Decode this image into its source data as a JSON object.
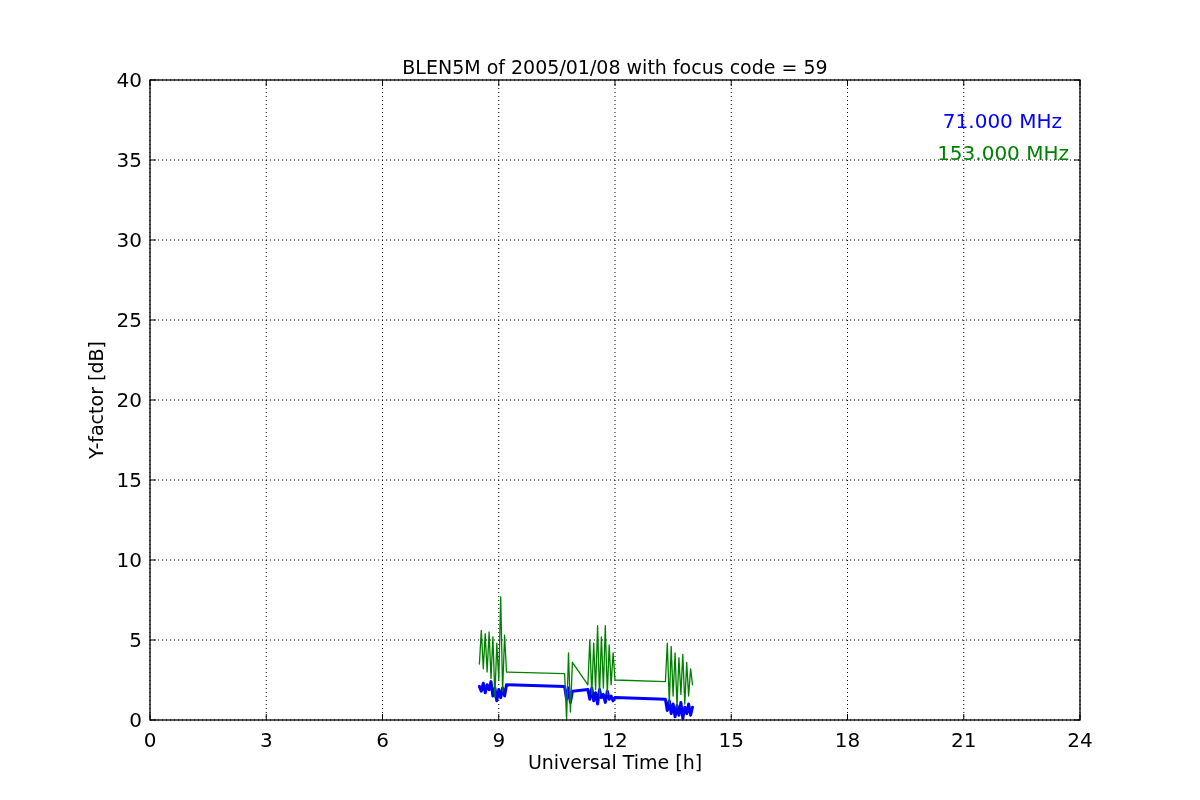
{
  "figure": {
    "chart_data": {
      "type": "line",
      "grid": true,
      "title": "BLEN5M of 2005/01/08 with focus code = 59",
      "xlabel": "Universal Time [h]",
      "ylabel": "Y-factor [dB]",
      "xlim": [
        0,
        24
      ],
      "ylim": [
        0,
        40
      ],
      "xticks": [
        0,
        3,
        6,
        9,
        12,
        15,
        18,
        21,
        24
      ],
      "yticks": [
        0,
        5,
        10,
        15,
        20,
        25,
        30,
        35,
        40
      ],
      "series": [
        {
          "name": "71.000 MHz",
          "color": "#0000ff",
          "x": [
            8.5,
            8.55,
            8.6,
            8.65,
            8.7,
            8.75,
            8.8,
            8.85,
            8.9,
            8.95,
            9.0,
            9.05,
            9.1,
            9.15,
            9.2,
            10.7,
            10.75,
            10.8,
            10.85,
            10.9,
            11.3,
            11.35,
            11.4,
            11.45,
            11.5,
            11.55,
            11.6,
            11.65,
            11.7,
            11.75,
            11.8,
            11.85,
            11.9,
            11.95,
            12.0,
            13.3,
            13.35,
            13.4,
            13.45,
            13.5,
            13.55,
            13.6,
            13.65,
            13.7,
            13.75,
            13.8,
            13.85,
            13.9,
            13.95,
            14.0
          ],
          "values": [
            2.1,
            1.8,
            2.3,
            1.7,
            2.2,
            1.9,
            2.4,
            1.5,
            2.0,
            1.2,
            1.9,
            1.4,
            2.0,
            1.5,
            2.2,
            2.1,
            1.3,
            2.0,
            1.1,
            1.8,
            1.9,
            1.3,
            2.0,
            1.2,
            1.7,
            1.0,
            1.9,
            1.4,
            1.6,
            1.1,
            1.8,
            1.3,
            1.5,
            1.2,
            1.4,
            1.3,
            0.6,
            1.2,
            0.4,
            1.0,
            0.2,
            0.9,
            0.3,
            1.1,
            0.1,
            0.8,
            0.4,
            1.0,
            0.3,
            0.8
          ]
        },
        {
          "name": "153.000 MHz",
          "color": "#008000",
          "x": [
            8.5,
            8.55,
            8.6,
            8.65,
            8.7,
            8.75,
            8.8,
            8.85,
            8.9,
            8.95,
            9.0,
            9.05,
            9.1,
            9.15,
            9.2,
            10.7,
            10.75,
            10.8,
            10.85,
            10.9,
            11.3,
            11.35,
            11.4,
            11.45,
            11.5,
            11.55,
            11.6,
            11.65,
            11.7,
            11.75,
            11.8,
            11.85,
            11.9,
            11.95,
            12.0,
            13.3,
            13.35,
            13.4,
            13.45,
            13.5,
            13.55,
            13.6,
            13.65,
            13.7,
            13.75,
            13.8,
            13.85,
            13.9,
            13.95,
            14.0
          ],
          "values": [
            3.5,
            5.6,
            3.2,
            5.4,
            3.0,
            5.5,
            2.6,
            5.2,
            1.4,
            4.8,
            2.5,
            7.7,
            1.8,
            5.3,
            3.0,
            2.9,
            0.0,
            4.2,
            0.5,
            3.6,
            2.2,
            5.0,
            1.6,
            4.8,
            1.9,
            5.9,
            1.5,
            5.2,
            2.0,
            5.9,
            1.6,
            4.7,
            2.2,
            4.2,
            2.5,
            2.4,
            4.8,
            1.0,
            4.6,
            1.5,
            4.2,
            0.8,
            3.9,
            1.6,
            4.1,
            1.0,
            3.6,
            1.5,
            3.2,
            2.2
          ]
        }
      ]
    }
  }
}
